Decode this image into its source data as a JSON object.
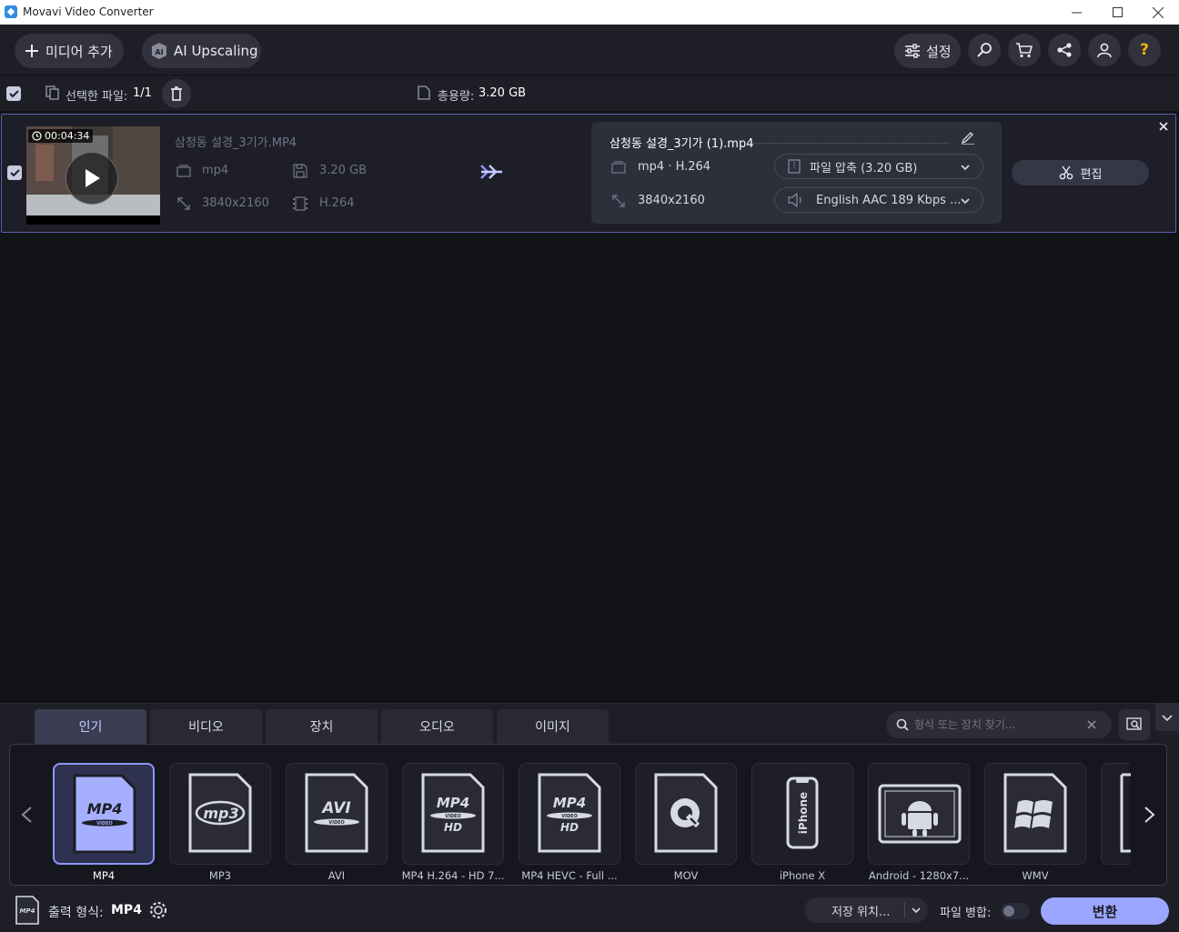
{
  "window": {
    "title": "Movavi Video Converter"
  },
  "toolbar": {
    "add_media_label": "미디어 추가",
    "ai_upscaling_label": "AI Upscaling",
    "settings_label": "설정"
  },
  "selection": {
    "selected_files_label": "선택한 파일:",
    "selected_files_value": "1/1",
    "total_size_label": "총용량:",
    "total_size_value": "3.20 GB"
  },
  "file": {
    "duration": "00:04:34",
    "source_name": "삼청동 설경_3기가.MP4",
    "source_format": "mp4",
    "source_size": "3.20 GB",
    "source_resolution": "3840x2160",
    "source_codec": "H.264",
    "output_name": "삼청동 설경_3기가 (1).mp4",
    "output_format": "mp4 · H.264",
    "output_resolution": "3840x2160",
    "compression_label": "파일 압축 (3.20 GB)",
    "audio_label": "English AAC 189 Kbps ...",
    "edit_label": "편집"
  },
  "tabs": [
    {
      "label": "인기"
    },
    {
      "label": "비디오"
    },
    {
      "label": "장치"
    },
    {
      "label": "오디오"
    },
    {
      "label": "이미지"
    }
  ],
  "search": {
    "placeholder": "형식 또는 장치 찾기..."
  },
  "formats": [
    {
      "label": "MP4",
      "icon": "mp4-icon"
    },
    {
      "label": "MP3",
      "icon": "mp3-icon"
    },
    {
      "label": "AVI",
      "icon": "avi-icon"
    },
    {
      "label": "MP4 H.264 - HD 7...",
      "icon": "mp4-hd-icon"
    },
    {
      "label": "MP4 HEVC - Full ...",
      "icon": "mp4-hevc-icon"
    },
    {
      "label": "MOV",
      "icon": "quicktime-icon"
    },
    {
      "label": "iPhone X",
      "icon": "iphone-icon"
    },
    {
      "label": "Android - 1280x7...",
      "icon": "android-icon"
    },
    {
      "label": "WMV",
      "icon": "windows-icon"
    }
  ],
  "footer": {
    "output_format_label": "출력 형식:",
    "output_format_value": "MP4",
    "save_location_label": "저장 위치...",
    "merge_label": "파일 병합:",
    "convert_label": "변환"
  },
  "colors": {
    "accent": "#8d96ff",
    "convert_button": "#9aa6ff",
    "background": "#121319",
    "panel": "#1d1e26"
  }
}
